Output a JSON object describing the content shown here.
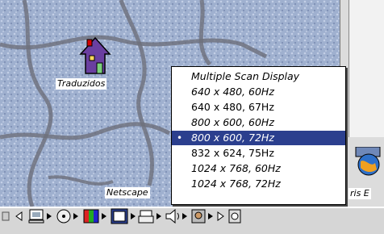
{
  "desktop": {
    "icons": [
      {
        "label": "Traduzidos"
      },
      {
        "label": "Netscape"
      },
      {
        "label": "ris E"
      }
    ]
  },
  "popup_menu": {
    "items": [
      {
        "label": "Multiple Scan Display",
        "italic": true,
        "selected": false
      },
      {
        "label": "640 x 480, 60Hz",
        "italic": true,
        "selected": false
      },
      {
        "label": "640 x 480, 67Hz",
        "italic": false,
        "selected": false
      },
      {
        "label": "800 x 600, 60Hz",
        "italic": true,
        "selected": false
      },
      {
        "label": "800 x 600, 72Hz",
        "italic": true,
        "selected": true
      },
      {
        "label": "832 x 624, 75Hz",
        "italic": false,
        "selected": false
      },
      {
        "label": "1024 x 768, 60Hz",
        "italic": true,
        "selected": false
      },
      {
        "label": "1024 x 768, 72Hz",
        "italic": true,
        "selected": false
      }
    ],
    "selected_mark": "•"
  },
  "control_strip": {
    "modules": [
      "computer-icon",
      "cd-icon",
      "color-depth-icon",
      "resolution-icon",
      "printer-icon",
      "sound-icon",
      "file-sharing-icon",
      "speaker-icon"
    ]
  },
  "colors": {
    "highlight": "#2b3f8e",
    "bar": "#d6d6d6"
  }
}
